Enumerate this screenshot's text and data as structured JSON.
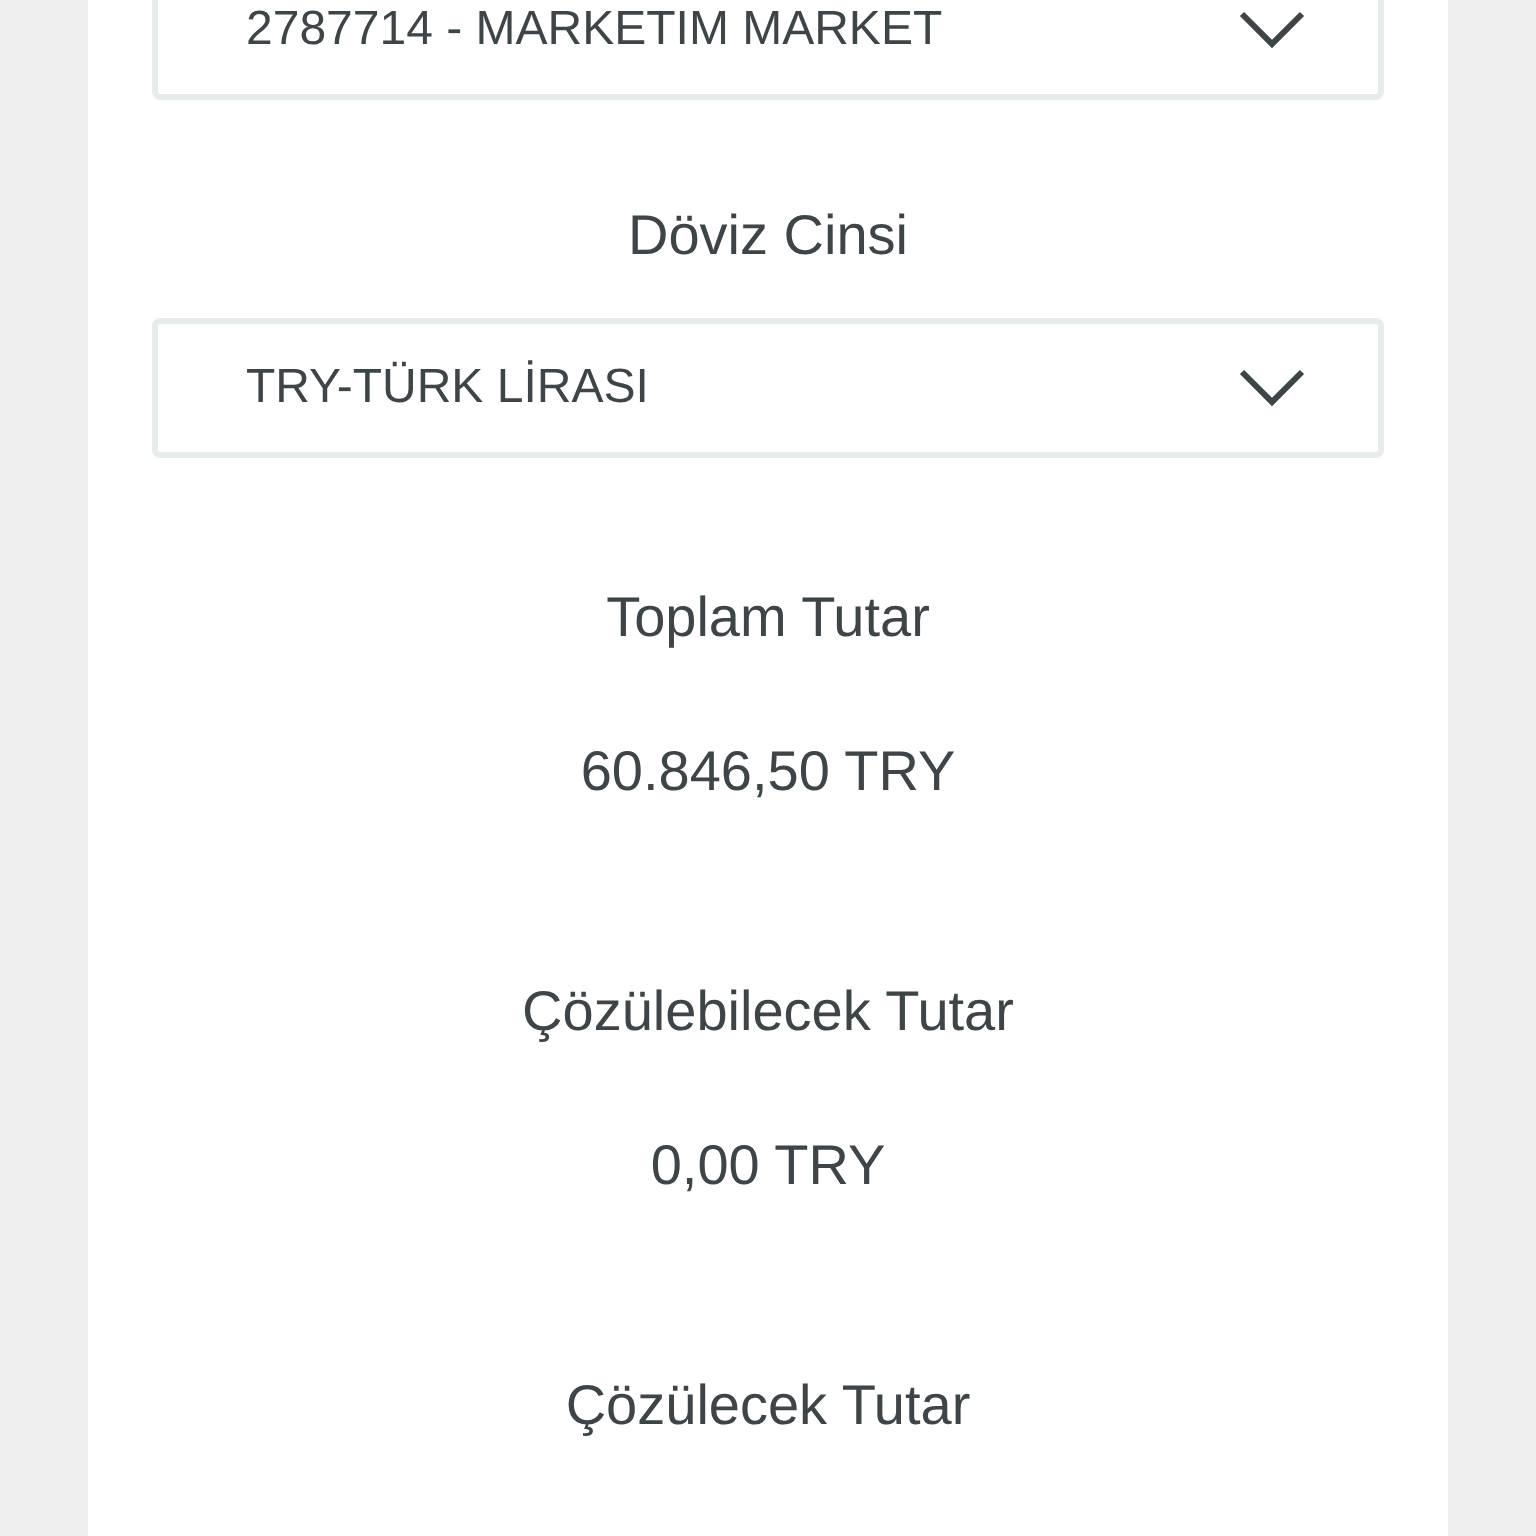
{
  "account_select": {
    "value": "2787714 - MARKETIM MARKET"
  },
  "currency": {
    "label": "Döviz Cinsi",
    "value": "TRY-TÜRK LİRASI"
  },
  "amounts": [
    {
      "label": "Toplam Tutar",
      "value": "60.846,50 TRY"
    },
    {
      "label": "Çözülebilecek Tutar",
      "value": "0,00 TRY"
    },
    {
      "label": "Çözülecek Tutar"
    }
  ]
}
